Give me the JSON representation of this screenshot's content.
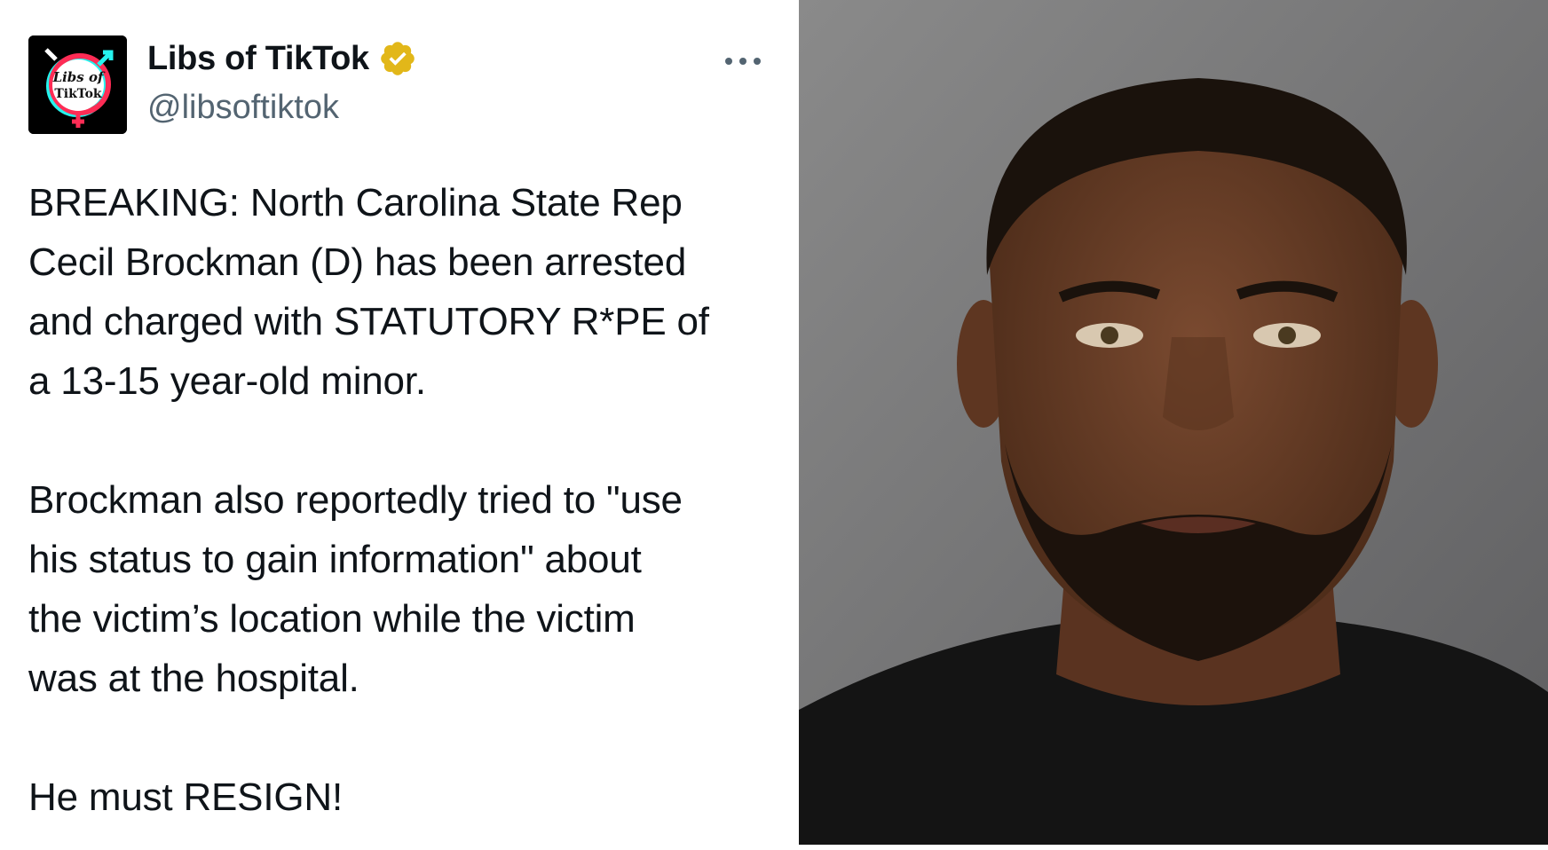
{
  "tweet": {
    "display_name": "Libs of TikTok",
    "handle": "@libsoftiktok",
    "avatar_text_line1": "Libs of",
    "avatar_text_line2": "TikTok",
    "paragraphs": [
      "BREAKING: North Carolina State Rep\nCecil Brockman (D) has been arrested\nand charged with STATUTORY R*PE of\na 13-15 year-old minor.",
      "Brockman also reportedly tried to \"use\nhis status to gain information\" about\nthe victim’s location while the victim\nwas at the hospital.",
      "He must RESIGN!"
    ],
    "icons": {
      "verified": "verified-badge-icon",
      "more": "more-options-icon"
    }
  },
  "colors": {
    "text": "#0f1419",
    "secondary_text": "#536471",
    "verified_gold": "#e2b719",
    "photo_background": "#6f6f6f"
  }
}
